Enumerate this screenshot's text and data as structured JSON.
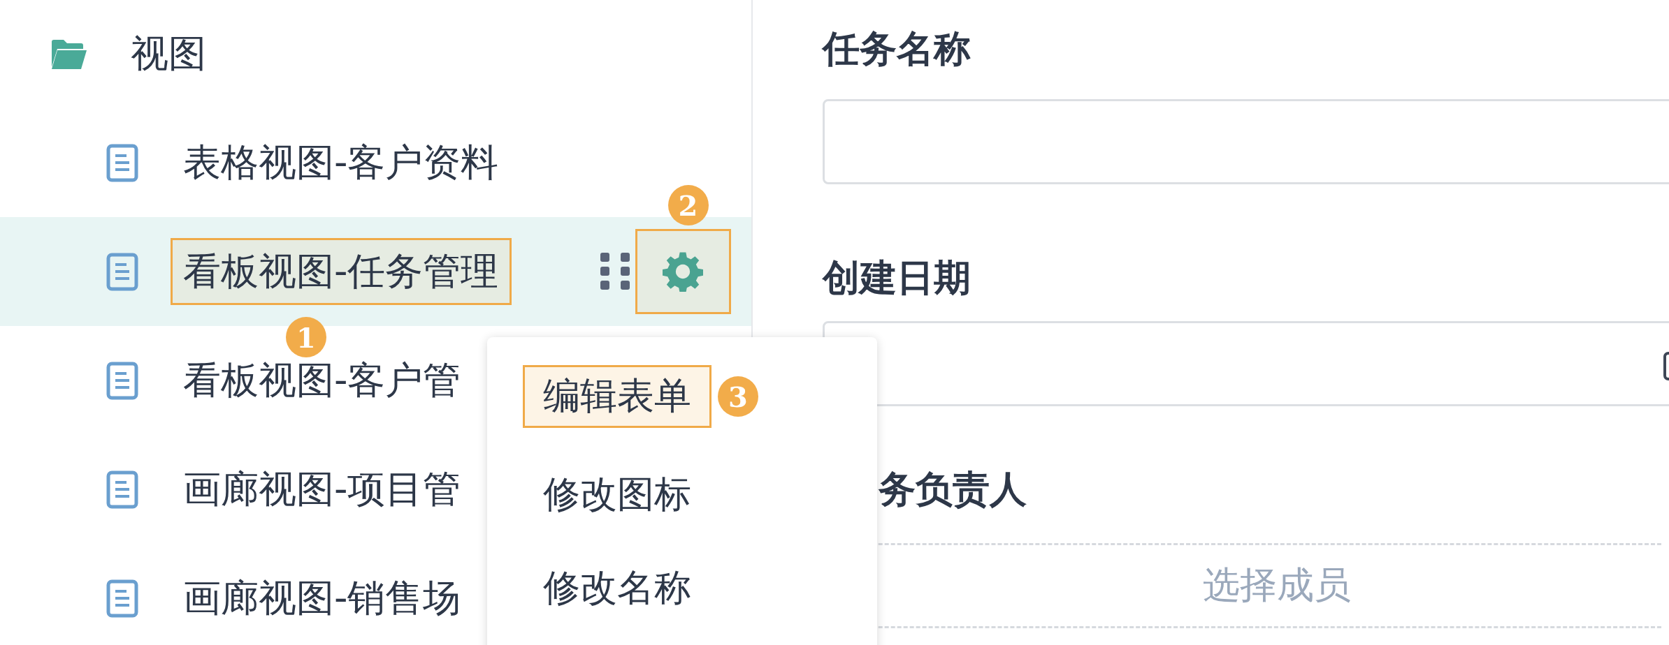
{
  "sidebar": {
    "folder": {
      "label": "视图",
      "expanded": true
    },
    "items": [
      {
        "label": "表格视图-客户资料",
        "selected": false,
        "highlighted": false
      },
      {
        "label": "看板视图-任务管理",
        "selected": true,
        "highlighted": true,
        "badge": "1"
      },
      {
        "label": "看板视图-客户管",
        "selected": false,
        "highlighted": false
      },
      {
        "label": "画廊视图-项目管",
        "selected": false,
        "highlighted": false
      },
      {
        "label": "画廊视图-销售场",
        "selected": false,
        "highlighted": false
      }
    ],
    "settings_button": {
      "highlighted": true,
      "badge": "2"
    }
  },
  "menu": {
    "items": [
      {
        "label": "编辑表单",
        "highlighted": true,
        "badge": "3"
      },
      {
        "label": "修改图标",
        "highlighted": false
      },
      {
        "label": "修改名称",
        "highlighted": false
      }
    ]
  },
  "form": {
    "fields": [
      {
        "kind": "text",
        "label": "任务名称"
      },
      {
        "kind": "date",
        "label": "创建日期"
      },
      {
        "kind": "member",
        "label": "务负责人",
        "placeholder": "选择成员"
      }
    ]
  }
}
